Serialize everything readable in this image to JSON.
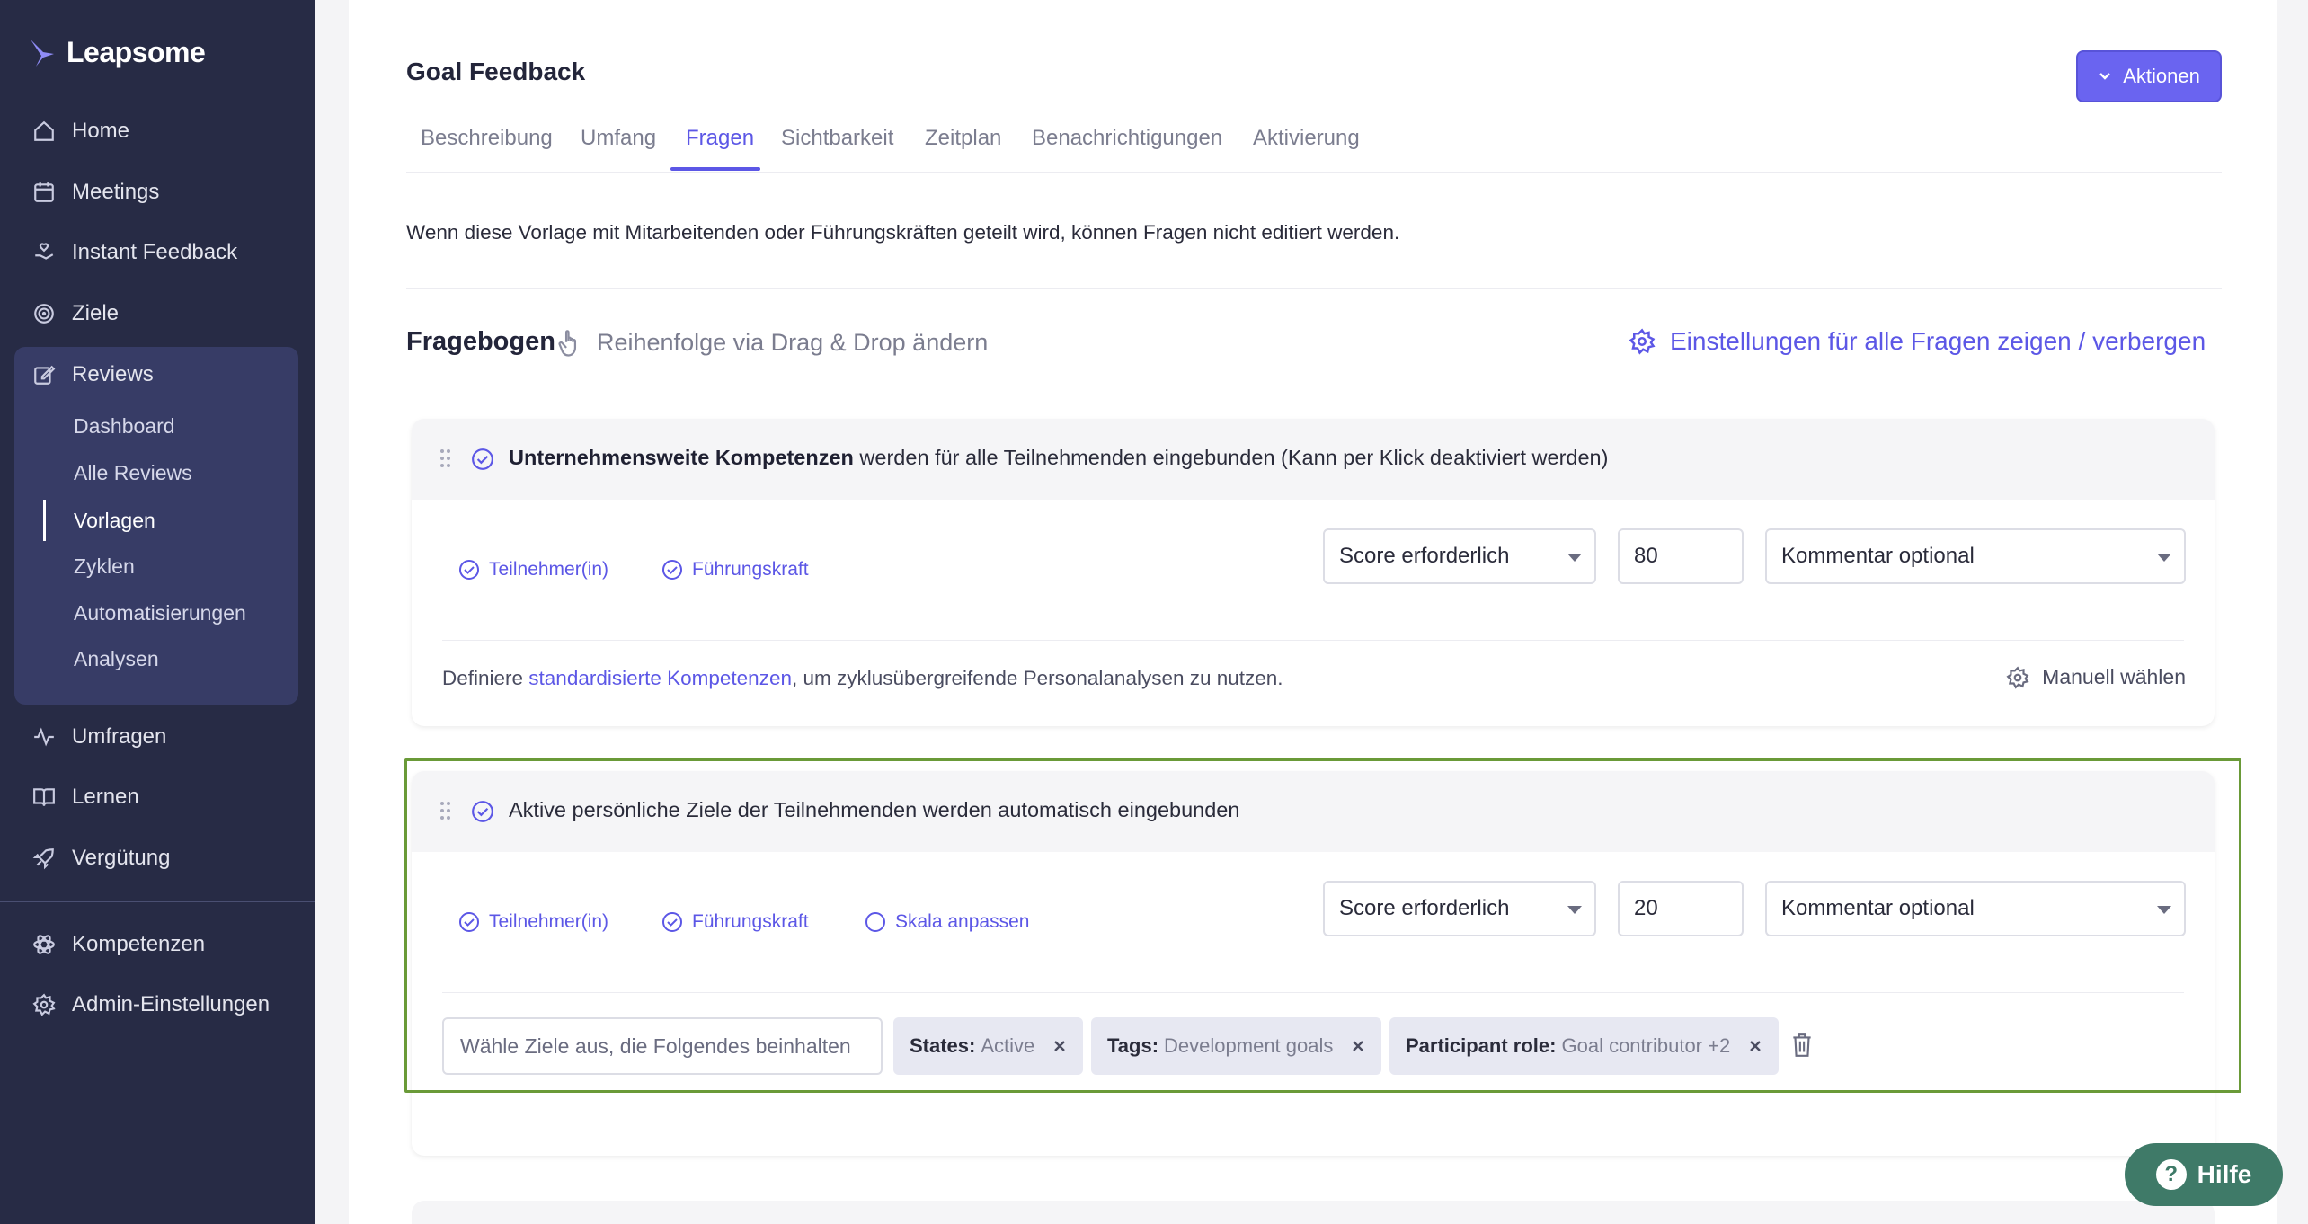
{
  "app": {
    "logo": "Leapsome"
  },
  "sidebar": {
    "items": [
      {
        "label": "Home",
        "icon": "home-icon"
      },
      {
        "label": "Meetings",
        "icon": "calendar-icon"
      },
      {
        "label": "Instant Feedback",
        "icon": "hand-heart-icon"
      },
      {
        "label": "Ziele",
        "icon": "target-icon"
      },
      {
        "label": "Reviews",
        "icon": "edit-icon"
      },
      {
        "label": "Umfragen",
        "icon": "pulse-icon"
      },
      {
        "label": "Lernen",
        "icon": "book-icon"
      },
      {
        "label": "Vergütung",
        "icon": "rocket-icon"
      },
      {
        "label": "Kompetenzen",
        "icon": "atom-icon"
      },
      {
        "label": "Admin-Einstellungen",
        "icon": "gear-icon"
      }
    ],
    "reviews_sub": [
      "Dashboard",
      "Alle Reviews",
      "Vorlagen",
      "Zyklen",
      "Automatisierungen",
      "Analysen"
    ]
  },
  "header": {
    "title": "Goal Feedback",
    "actions_label": "Aktionen"
  },
  "tabs": [
    "Beschreibung",
    "Umfang",
    "Fragen",
    "Sichtbarkeit",
    "Zeitplan",
    "Benachrichtigungen",
    "Aktivierung"
  ],
  "notice": "Wenn diese Vorlage mit Mitarbeitenden oder Führungskräften geteilt wird, können Fragen nicht editiert werden.",
  "questionnaire": {
    "title": "Fragebogen",
    "reorder_hint": "Reihenfolge via Drag & Drop ändern",
    "settings_toggle": "Einstellungen für alle Fragen zeigen / verbergen"
  },
  "card1": {
    "bold": "Unternehmensweite Kompetenzen",
    "rest": " werden für alle Teilnehmenden eingebunden (Kann per Klick deaktiviert werden)",
    "chip_participant": "Teilnehmer(in)",
    "chip_manager": "Führungskraft",
    "score_select": "Score erforderlich",
    "weight": "80",
    "comment_select": "Kommentar optional",
    "define_prefix": "Definiere ",
    "define_link": "standardisierte Kompetenzen",
    "define_suffix": ", um zyklusübergreifende Personalanalysen zu nutzen.",
    "manual": "Manuell wählen"
  },
  "card2": {
    "title": "Aktive persönliche Ziele der Teilnehmenden werden automatisch eingebunden",
    "chip_participant": "Teilnehmer(in)",
    "chip_manager": "Führungskraft",
    "chip_scale": "Skala anpassen",
    "score_select": "Score erforderlich",
    "weight": "20",
    "comment_select": "Kommentar optional",
    "goal_input_placeholder": "Wähle Ziele aus, die Folgendes beinhalten",
    "filters": [
      {
        "key": "States:",
        "value": "Active"
      },
      {
        "key": "Tags:",
        "value": "Development goals"
      },
      {
        "key": "Participant role:",
        "value": "Goal contributor +2"
      }
    ]
  },
  "help": {
    "label": "Hilfe",
    "mark": "?"
  },
  "colors": {
    "accent": "#5c57e6",
    "sidebar": "#272b45",
    "highlight": "#6a9a38",
    "help": "#3f7a68"
  }
}
